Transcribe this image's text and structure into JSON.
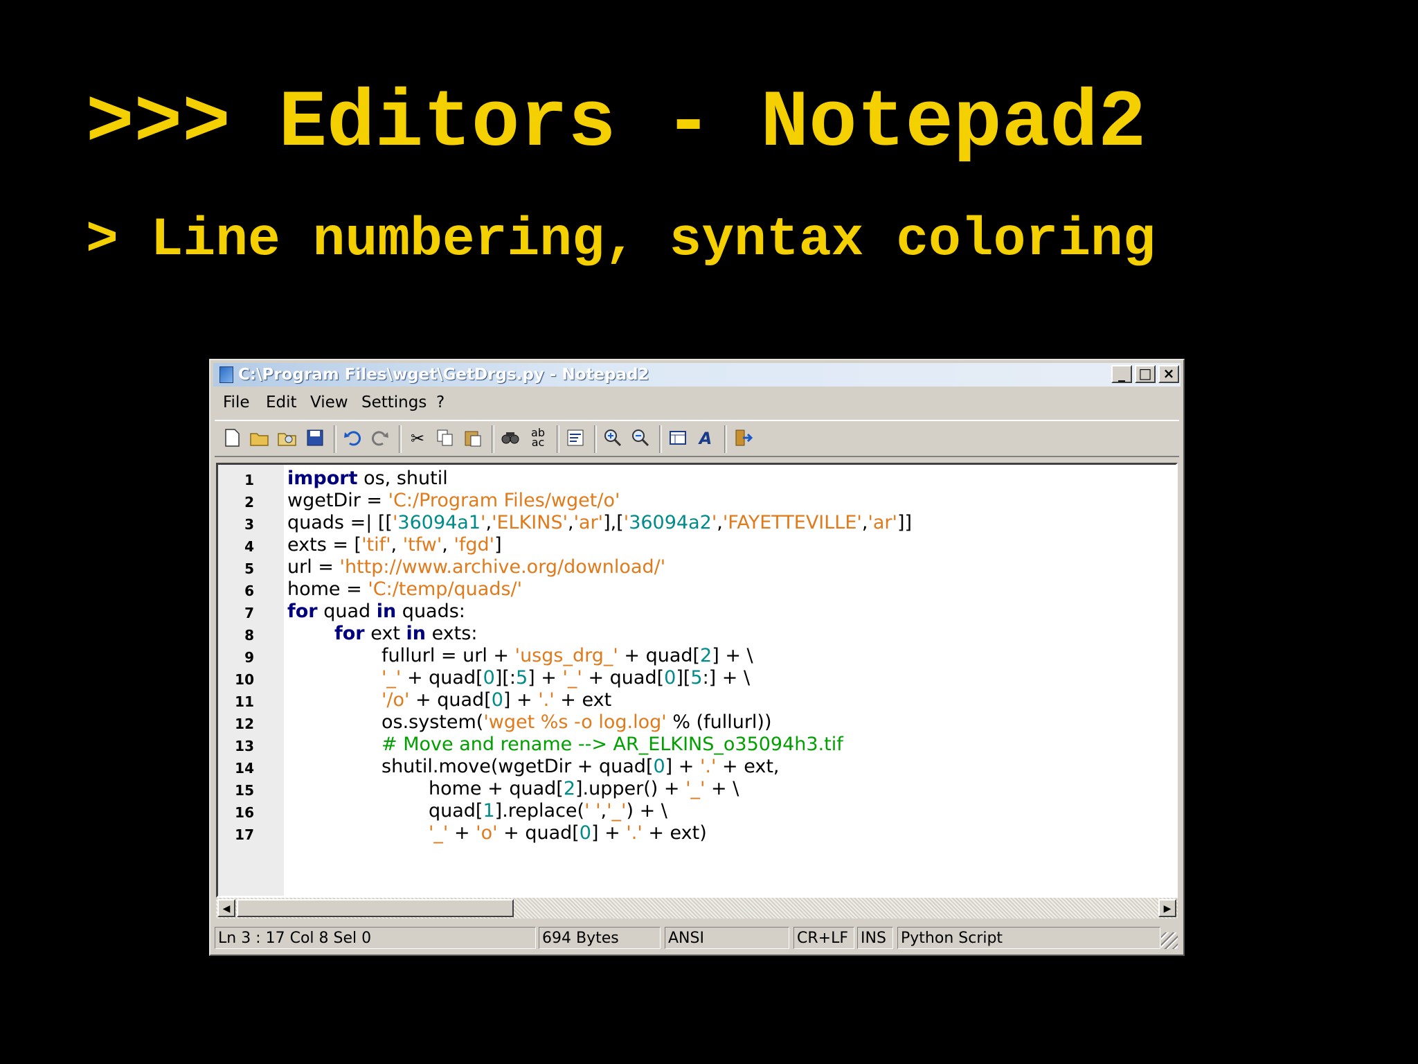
{
  "slide": {
    "title": ">>> Editors - Notepad2",
    "subtitle": "> Line numbering, syntax coloring"
  },
  "window": {
    "title": "C:\\Program Files\\wget\\GetDrgs.py - Notepad2",
    "controls": {
      "minimize": "_",
      "maximize": "□",
      "close": "×"
    }
  },
  "menu": [
    "File",
    "Edit",
    "View",
    "Settings",
    "?"
  ],
  "toolbar_icons": [
    "new-file-icon",
    "open-folder-icon",
    "browse-icon",
    "save-icon",
    "undo-icon",
    "redo-icon",
    "cut-icon",
    "copy-icon",
    "paste-icon",
    "find-icon",
    "replace-icon",
    "word-wrap-icon",
    "zoom-in-icon",
    "zoom-out-icon",
    "scheme-icon",
    "font-icon",
    "exit-icon"
  ],
  "colors": {
    "keyword": "#00007f",
    "string": "#e07a1a",
    "number": "#008b8b",
    "comment": "#00a000",
    "default": "#000000"
  },
  "code_lines": [
    {
      "n": "1",
      "indent": 0,
      "tokens": [
        [
          "import",
          "keyword"
        ],
        [
          " os, shutil",
          "default"
        ]
      ]
    },
    {
      "n": "2",
      "indent": 0,
      "tokens": [
        [
          "wgetDir = ",
          "default"
        ],
        [
          "'C:/Program Files/wget/o'",
          "string"
        ]
      ]
    },
    {
      "n": "3",
      "indent": 0,
      "tokens": [
        [
          "quads =| [[",
          "default"
        ],
        [
          "'",
          "string"
        ],
        [
          "36094a1",
          "number"
        ],
        [
          "'",
          "string"
        ],
        [
          ",",
          "default"
        ],
        [
          "'ELKINS'",
          "string"
        ],
        [
          ",",
          "default"
        ],
        [
          "'ar'",
          "string"
        ],
        [
          "],[",
          "default"
        ],
        [
          "'",
          "string"
        ],
        [
          "36094a2",
          "number"
        ],
        [
          "'",
          "string"
        ],
        [
          ",",
          "default"
        ],
        [
          "'FAYETTEVILLE'",
          "string"
        ],
        [
          ",",
          "default"
        ],
        [
          "'ar'",
          "string"
        ],
        [
          "]]",
          "default"
        ]
      ]
    },
    {
      "n": "4",
      "indent": 0,
      "tokens": [
        [
          "exts = [",
          "default"
        ],
        [
          "'tif'",
          "string"
        ],
        [
          ", ",
          "default"
        ],
        [
          "'tfw'",
          "string"
        ],
        [
          ", ",
          "default"
        ],
        [
          "'fgd'",
          "string"
        ],
        [
          "]",
          "default"
        ]
      ]
    },
    {
      "n": "5",
      "indent": 0,
      "tokens": [
        [
          "url = ",
          "default"
        ],
        [
          "'http://www.archive.org/download/'",
          "string"
        ]
      ]
    },
    {
      "n": "6",
      "indent": 0,
      "tokens": [
        [
          "home = ",
          "default"
        ],
        [
          "'C:/temp/quads/'",
          "string"
        ]
      ]
    },
    {
      "n": "7",
      "indent": 0,
      "tokens": [
        [
          "for",
          "keyword"
        ],
        [
          " quad ",
          "default"
        ],
        [
          "in",
          "keyword"
        ],
        [
          " quads:",
          "default"
        ]
      ]
    },
    {
      "n": "8",
      "indent": 1,
      "tokens": [
        [
          "for",
          "keyword"
        ],
        [
          " ext ",
          "default"
        ],
        [
          "in",
          "keyword"
        ],
        [
          " exts:",
          "default"
        ]
      ]
    },
    {
      "n": "9",
      "indent": 2,
      "tokens": [
        [
          "fullurl = url + ",
          "default"
        ],
        [
          "'usgs_drg_'",
          "string"
        ],
        [
          " + quad[",
          "default"
        ],
        [
          "2",
          "number"
        ],
        [
          "] + \\",
          "default"
        ]
      ]
    },
    {
      "n": "10",
      "indent": 2,
      "tokens": [
        [
          "'_'",
          "string"
        ],
        [
          " + quad[",
          "default"
        ],
        [
          "0",
          "number"
        ],
        [
          "][:",
          "default"
        ],
        [
          "5",
          "number"
        ],
        [
          "] + ",
          "default"
        ],
        [
          "'_'",
          "string"
        ],
        [
          " + quad[",
          "default"
        ],
        [
          "0",
          "number"
        ],
        [
          "][",
          "default"
        ],
        [
          "5",
          "number"
        ],
        [
          ":] + \\",
          "default"
        ]
      ]
    },
    {
      "n": "11",
      "indent": 2,
      "tokens": [
        [
          "'/o'",
          "string"
        ],
        [
          " + quad[",
          "default"
        ],
        [
          "0",
          "number"
        ],
        [
          "] + ",
          "default"
        ],
        [
          "'.'",
          "string"
        ],
        [
          " + ext",
          "default"
        ]
      ]
    },
    {
      "n": "12",
      "indent": 2,
      "tokens": [
        [
          "os.system(",
          "default"
        ],
        [
          "'wget %s -o log.log'",
          "string"
        ],
        [
          " % (fullurl))",
          "default"
        ]
      ]
    },
    {
      "n": "13",
      "indent": 2,
      "tokens": [
        [
          "# Move and rename --> AR_ELKINS_o35094h3.tif",
          "comment"
        ]
      ]
    },
    {
      "n": "14",
      "indent": 2,
      "tokens": [
        [
          "shutil.move(wgetDir + quad[",
          "default"
        ],
        [
          "0",
          "number"
        ],
        [
          "] + ",
          "default"
        ],
        [
          "'.'",
          "string"
        ],
        [
          " + ext,",
          "default"
        ]
      ]
    },
    {
      "n": "15",
      "indent": 3,
      "tokens": [
        [
          "home + quad[",
          "default"
        ],
        [
          "2",
          "number"
        ],
        [
          "].upper() + ",
          "default"
        ],
        [
          "'_'",
          "string"
        ],
        [
          " + \\",
          "default"
        ]
      ]
    },
    {
      "n": "16",
      "indent": 3,
      "tokens": [
        [
          "quad[",
          "default"
        ],
        [
          "1",
          "number"
        ],
        [
          "].replace(",
          "default"
        ],
        [
          "' '",
          "string"
        ],
        [
          ",",
          "default"
        ],
        [
          "'_'",
          "string"
        ],
        [
          ") + \\",
          "default"
        ]
      ]
    },
    {
      "n": "17",
      "indent": 3,
      "tokens": [
        [
          "'_'",
          "string"
        ],
        [
          " + ",
          "default"
        ],
        [
          "'o'",
          "string"
        ],
        [
          " + quad[",
          "default"
        ],
        [
          "0",
          "number"
        ],
        [
          "] + ",
          "default"
        ],
        [
          "'.'",
          "string"
        ],
        [
          " + ext)",
          "default"
        ]
      ]
    }
  ],
  "status": {
    "position": "Ln 3 : 17   Col 8   Sel 0",
    "size": "694 Bytes",
    "encoding": "ANSI",
    "line_endings": "CR+LF",
    "mode": "INS",
    "scheme": "Python Script"
  },
  "scrollbar": {
    "left_arrow": "◀",
    "right_arrow": "▶"
  }
}
